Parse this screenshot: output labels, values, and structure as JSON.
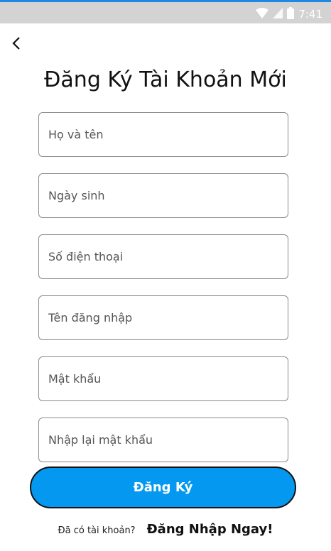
{
  "status_bar": {
    "time": "7:41",
    "icons": [
      "wifi-icon",
      "signal-icon",
      "battery-icon"
    ]
  },
  "header": {
    "back_icon": "chevron-left-icon",
    "title": "Đăng Ký Tài Khoản Mới"
  },
  "form": {
    "fields": [
      {
        "placeholder": "Họ và tên",
        "value": ""
      },
      {
        "placeholder": "Ngày sinh",
        "value": ""
      },
      {
        "placeholder": "Số điện thoại",
        "value": ""
      },
      {
        "placeholder": "Tên đăng nhập",
        "value": ""
      },
      {
        "placeholder": "Mật khẩu",
        "value": ""
      },
      {
        "placeholder": "Nhập lại mật khẩu",
        "value": ""
      }
    ],
    "submit_label": "Đăng Ký"
  },
  "footer": {
    "question": "Đã có tài khoản?",
    "login_link": "Đăng Nhập Ngay!"
  },
  "colors": {
    "accent": "#0598f0",
    "status_bar": "#d3d3d3"
  }
}
